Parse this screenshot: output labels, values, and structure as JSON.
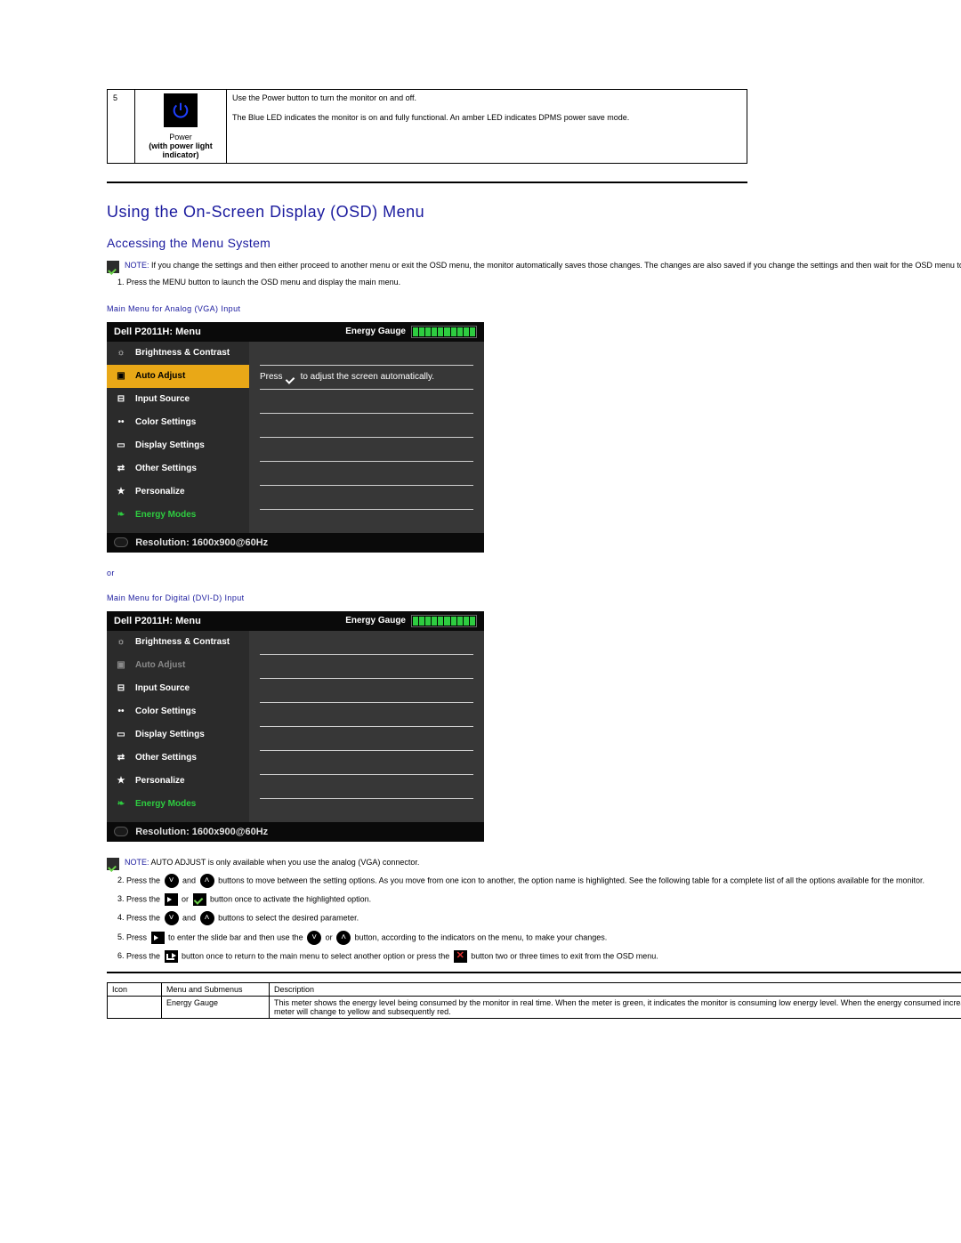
{
  "powerRow": {
    "num": "5",
    "label1": "Power",
    "label2": "(with power light indicator)",
    "desc1": "Use the Power button to turn the monitor on and off.",
    "desc2": "The Blue LED indicates the monitor is on and fully functional. An amber LED indicates DPMS power save mode."
  },
  "headings": {
    "h1": "Using the On-Screen Display (OSD) Menu",
    "h2": "Accessing the Menu System"
  },
  "note1": {
    "prefix": "NOTE:",
    "text": " If you change the settings and then either proceed to another menu or exit the OSD menu, the monitor automatically saves those changes. The changes are also saved if you change the settings and then wait for the OSD menu to disappear."
  },
  "step1": "Press the MENU button to launch the OSD menu and display the main menu.",
  "captions": {
    "vga": "Main Menu for Analog (VGA) Input",
    "or": "or",
    "dvi": "Main Menu for Digital (DVI-D) Input"
  },
  "osd": {
    "title": "Dell P2011H: Menu",
    "gaugeLabel": "Energy Gauge",
    "items": {
      "brightness": "Brightness & Contrast",
      "auto": "Auto Adjust",
      "input": "Input Source",
      "color": "Color Settings",
      "display": "Display Settings",
      "other": "Other Settings",
      "personalize": "Personalize",
      "energy": "Energy Modes"
    },
    "hintPrefix": "Press",
    "hintSuffix": "to adjust the screen automatically.",
    "resolutionLabel": "Resolution: 1600x900@60Hz"
  },
  "note2": {
    "prefix": "NOTE:",
    "text": " AUTO ADJUST is only available when you use the analog (VGA) connector."
  },
  "steps2to6": {
    "s2a": "Press the ",
    "s2b": " and ",
    "s2c": " buttons to move between the setting options. As you move from one icon to another, the option name is highlighted. See the following table for a complete list of all the options available for the monitor.",
    "s3a": "Press the ",
    "s3b": " or ",
    "s3c": " button once to activate the highlighted option.",
    "s4a": "Press the ",
    "s4b": " and ",
    "s4c": " buttons to select the desired parameter.",
    "s5a": "Press ",
    "s5b": " to enter the slide bar and then use the ",
    "s5c": " or ",
    "s5d": " button, according to the indicators on the menu, to make your changes.",
    "s6a": "Press the ",
    "s6b": " button once to return to the main menu to select another option or press the ",
    "s6c": " button two or three times to exit from the OSD menu."
  },
  "legend": {
    "colIcon": "Icon",
    "colMenu": "Menu and Submenus",
    "colDesc": "Description",
    "row1Menu": "Energy Gauge",
    "row1Desc": "This meter shows the energy level being consumed by the monitor in real time. When the meter is green, it indicates the monitor is consuming low energy level. When the energy consumed increases, the meter will change to yellow and subsequently red."
  }
}
